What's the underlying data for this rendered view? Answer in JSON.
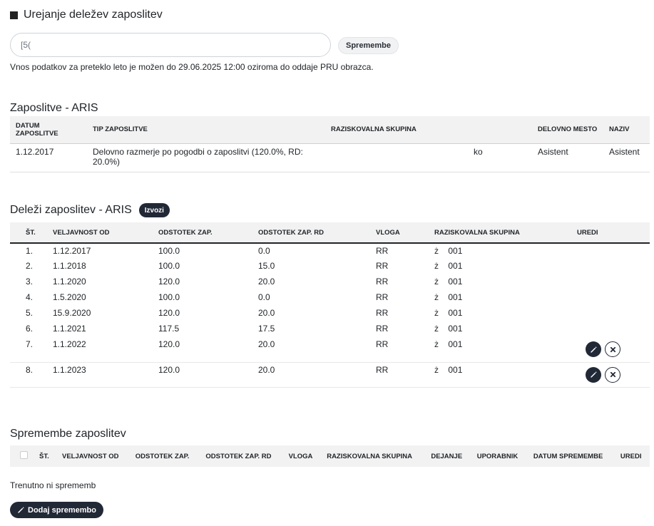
{
  "header": {
    "title": "Urejanje deležev zaposlitev"
  },
  "select": {
    "value": "[5("
  },
  "changes_button": "Spremembe",
  "info_text": "Vnos podatkov za preteklo leto je možen do 29.06.2025 12:00 oziroma do oddaje PRU obrazca.",
  "employments": {
    "title": "Zaposlitve - ARIS",
    "columns": [
      "DATUM ZAPOSLITVE",
      "TIP ZAPOSLITVE",
      "RAZISKOVALNA SKUPINA",
      "",
      "DELOVNO MESTO",
      "NAZIV"
    ],
    "rows": [
      {
        "date": "1.12.2017",
        "type": "Delovno razmerje po pogodbi o zaposlitvi (120.0%, RD: 20.0%)",
        "group": "",
        "group_extra": "ko",
        "workplace": "Asistent",
        "title": "Asistent"
      }
    ]
  },
  "shares": {
    "title": "Deleži zaposlitev - ARIS",
    "export_label": "Izvozi",
    "columns": [
      "ŠT.",
      "VELJAVNOST OD",
      "ODSTOTEK ZAP.",
      "ODSTOTEK ZAP. RD",
      "VLOGA",
      "RAZISKOVALNA SKUPINA",
      "UREDI"
    ],
    "rows": [
      {
        "n": "1.",
        "from": "1.12.2017",
        "pct": "100.0",
        "pct_rd": "0.0",
        "role": "RR",
        "grp_a": "ż",
        "grp_b": "001"
      },
      {
        "n": "2.",
        "from": "1.1.2018",
        "pct": "100.0",
        "pct_rd": "15.0",
        "role": "RR",
        "grp_a": "ż",
        "grp_b": "001"
      },
      {
        "n": "3.",
        "from": "1.1.2020",
        "pct": "120.0",
        "pct_rd": "20.0",
        "role": "RR",
        "grp_a": "ż",
        "grp_b": "001"
      },
      {
        "n": "4.",
        "from": "1.5.2020",
        "pct": "100.0",
        "pct_rd": "0.0",
        "role": "RR",
        "grp_a": "ż",
        "grp_b": "001"
      },
      {
        "n": "5.",
        "from": "15.9.2020",
        "pct": "120.0",
        "pct_rd": "20.0",
        "role": "RR",
        "grp_a": "ż",
        "grp_b": "001"
      },
      {
        "n": "6.",
        "from": "1.1.2021",
        "pct": "117.5",
        "pct_rd": "17.5",
        "role": "RR",
        "grp_a": "ż",
        "grp_b": "001"
      },
      {
        "n": "7.",
        "from": "1.1.2022",
        "pct": "120.0",
        "pct_rd": "20.0",
        "role": "RR",
        "grp_a": "ż",
        "grp_b": "001"
      },
      {
        "n": "8.",
        "from": "1.1.2023",
        "pct": "120.0",
        "pct_rd": "20.0",
        "role": "RR",
        "grp_a": "ż",
        "grp_b": "001"
      }
    ]
  },
  "changes": {
    "title": "Spremembe zaposlitev",
    "columns": [
      "ŠT.",
      "VELJAVNOST OD",
      "ODSTOTEK ZAP.",
      "ODSTOTEK ZAP. RD",
      "VLOGA",
      "RAZISKOVALNA SKUPINA",
      "DEJANJE",
      "UPORABNIK",
      "DATUM SPREMEMBE",
      "UREDI"
    ],
    "empty_text": "Trenutno ni sprememb",
    "add_label": "Dodaj spremembo"
  },
  "icons": {
    "heading": "square-icon",
    "edit": "pencil-icon",
    "delete": "close-icon"
  },
  "colors": {
    "dark_button": "#212836",
    "header_bg": "#f2f2f2"
  }
}
